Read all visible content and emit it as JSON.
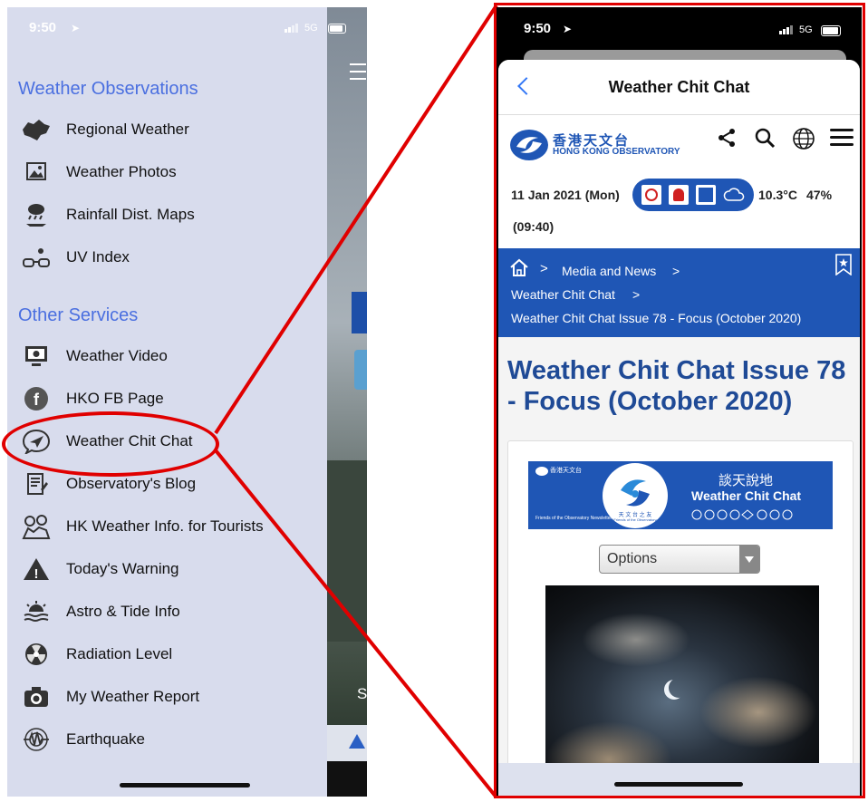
{
  "left": {
    "status": {
      "time": "9:50",
      "signal": "5G"
    },
    "sections": [
      {
        "title": "Weather Observations"
      },
      {
        "title": "Other Services"
      }
    ],
    "items": [
      {
        "label": "Regional Weather",
        "icon": "map-icon"
      },
      {
        "label": "Weather Photos",
        "icon": "photo-icon"
      },
      {
        "label": "Rainfall Dist. Maps",
        "icon": "rain-icon"
      },
      {
        "label": "UV Index",
        "icon": "sunglasses-icon"
      },
      {
        "label": "Weather Video",
        "icon": "video-icon"
      },
      {
        "label": "HKO FB Page",
        "icon": "facebook-icon"
      },
      {
        "label": "Weather Chit Chat",
        "icon": "chat-icon"
      },
      {
        "label": "Observatory's Blog",
        "icon": "blog-icon"
      },
      {
        "label": "HK Weather Info. for Tourists",
        "icon": "tourist-icon"
      },
      {
        "label": "Today's Warning",
        "icon": "warning-icon"
      },
      {
        "label": "Astro & Tide Info",
        "icon": "tide-icon"
      },
      {
        "label": "Radiation Level",
        "icon": "radiation-icon"
      },
      {
        "label": "My Weather Report",
        "icon": "camera-icon"
      },
      {
        "label": "Earthquake",
        "icon": "earthquake-icon"
      }
    ]
  },
  "right": {
    "status": {
      "time": "9:50",
      "signal": "5G"
    },
    "nav_title": "Weather Chit Chat",
    "logo": {
      "chinese": "香港天文台",
      "english": "HONG KONG OBSERVATORY"
    },
    "weather": {
      "date": "11 Jan 2021 (Mon)",
      "temperature": "10.3°C",
      "humidity": "47%",
      "time": "(09:40)"
    },
    "breadcrumb": [
      "Media and News",
      "Weather Chit Chat",
      "Weather Chit Chat Issue 78 - Focus (October 2020)"
    ],
    "page_title": "Weather Chit Chat Issue 78 - Focus (October 2020)",
    "banner": {
      "chinese_title": "談天說地",
      "english_title": "Weather Chit Chat",
      "hko_small": "香港天文台",
      "friends_cn": "天 文 台 之 友",
      "friends_en": "Friends of the Observatory",
      "newsletter": "Friends of the Observatory Newsletter"
    },
    "options_label": "Options"
  },
  "colors": {
    "accent_blue": "#1f56b5",
    "section_blue": "#4a6fe0",
    "highlight_red": "#e00000"
  }
}
